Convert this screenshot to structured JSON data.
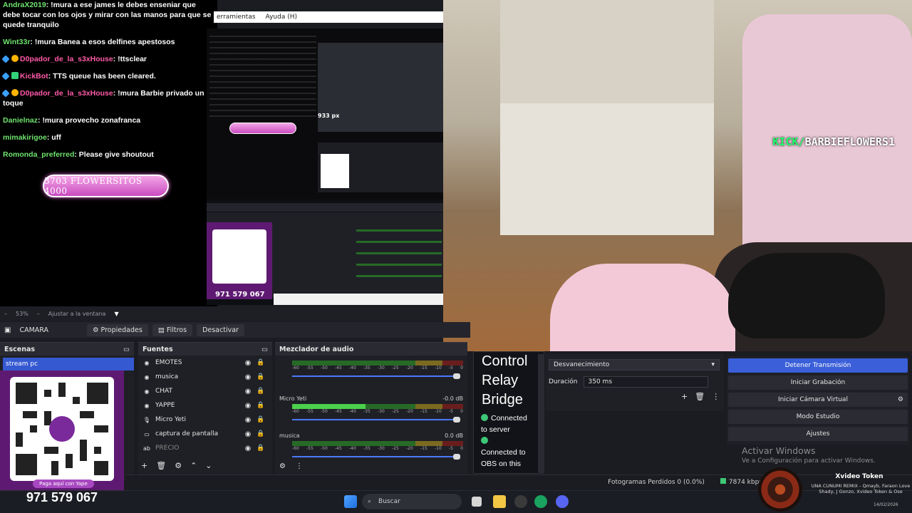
{
  "chat": {
    "lines": [
      {
        "user": "AndraX2019",
        "text": "!mura a ese james le debes enseniar que debe tocar con los ojos y mirar con las manos para que se quede tranquilo"
      },
      {
        "user": "Wint33r",
        "text": "!mura Banea a esos delfines apestosos"
      },
      {
        "user": "D0pador_de_la_s3xHouse",
        "text": "!ttsclear"
      },
      {
        "user": "KickBot",
        "text": "TTS queue has been cleared."
      },
      {
        "user": "D0pador_de_la_s3xHouse",
        "text": "!mura Barbie privado un toque"
      },
      {
        "user": "Danielnaz",
        "text": "!mura provecho zonafranca"
      },
      {
        "user": "mimakirigoe",
        "text": "uff"
      },
      {
        "user": "Romonda_preferred",
        "text": "Please give shoutout"
      }
    ],
    "flowers_label": "3703 FLOWERSITOS 4000"
  },
  "overlay": {
    "kick_prefix": "KICK/",
    "kick_channel": "BARBIEFLOWERS1",
    "menu_partial_1": "erramientas",
    "menu_partial_2": "Ayuda (H)",
    "preview_px": "933 px"
  },
  "obs": {
    "zoom": "53%",
    "fit_label": "Ajustar a la ventana",
    "scene_name": "CAMARA",
    "toolbar": {
      "properties": "Propiedades",
      "filters": "Filtros",
      "disable": "Desactivar"
    },
    "scenes_title": "Escenas",
    "scenes": [
      "stream pc"
    ],
    "sources_title": "Fuentes",
    "sources": [
      {
        "name": "EMOTES",
        "icon": "emote-icon"
      },
      {
        "name": "musica",
        "icon": "globe-icon"
      },
      {
        "name": "CHAT",
        "icon": "globe-icon"
      },
      {
        "name": "YAPPE",
        "icon": "globe-icon"
      },
      {
        "name": "Micro Yeti",
        "icon": "mic-icon"
      },
      {
        "name": "captura de pantalla",
        "icon": "monitor-icon"
      },
      {
        "name": "PRECIO",
        "icon": "text-icon"
      }
    ],
    "mixer_title": "Mezclador de audio",
    "mixer": [
      {
        "name": "",
        "db": "",
        "level": 0.0
      },
      {
        "name": "Micro Yeti",
        "db": "-0.0 dB",
        "level": 0.43
      },
      {
        "name": "musica",
        "db": "0.0 dB",
        "level": 0.0
      }
    ],
    "ticks": [
      "-60",
      "-55",
      "-50",
      "-45",
      "-40",
      "-35",
      "-30",
      "-25",
      "-20",
      "-15",
      "-10",
      "-5",
      "0"
    ],
    "relay": {
      "title1": "Control",
      "title2": "Relay",
      "title3": "Bridge",
      "status1": "Connected",
      "status1b": "to server",
      "status2": "Connected to",
      "status2b": "OBS on this"
    },
    "transition": {
      "type": "Desvanecimiento",
      "duration_label": "Duración",
      "duration": "350 ms"
    },
    "controls": {
      "stop_stream": "Detener Transmisión",
      "record": "Iniciar Grabación",
      "virtual_cam": "Iniciar Cámara Virtual",
      "studio": "Modo Estudio",
      "settings": "Ajustes"
    },
    "status": {
      "dropped": "Fotogramas Perdidos 0 (0.0%)",
      "bitrate": "7874 kbps"
    }
  },
  "windows": {
    "activate_title": "Activar Windows",
    "activate_sub": "Ve a Configuración para activar Windows.",
    "search": "Buscar",
    "date": "14/02/2026"
  },
  "qr": {
    "pill": "Paga aquí con Yape",
    "phone": "971 579 067"
  },
  "music": {
    "title": "Xvideo Token",
    "sub": "UNA CUNUMI REMIX - Qmayb, Faraon Love Shady, J Gonzo, Xvideo Token & Ose"
  }
}
